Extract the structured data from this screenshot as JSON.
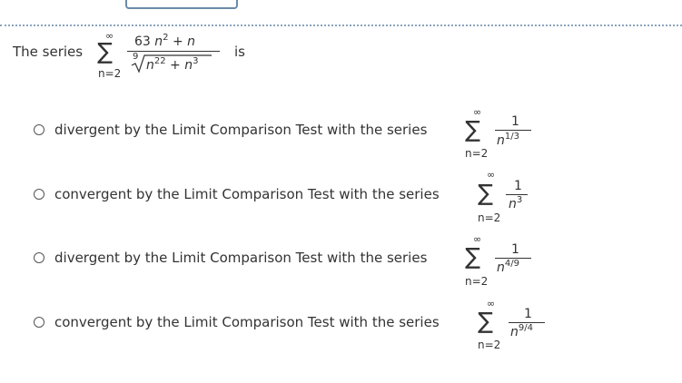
{
  "question": {
    "prefix": "The series",
    "suffix": "is",
    "sum_upper": "∞",
    "sum_lower": "n=2",
    "numerator": "63 n² + n",
    "root_index": "9",
    "radicand": "n²² + n³"
  },
  "options": [
    {
      "text": "divergent by the Limit Comparison Test with the series",
      "sum_upper": "∞",
      "sum_lower": "n=2",
      "numerator": "1",
      "denominator": "n^1/3",
      "den_base": "n",
      "den_exp": "1/3"
    },
    {
      "text": "convergent by the Limit Comparison Test with the series",
      "sum_upper": "∞",
      "sum_lower": "n=2",
      "numerator": "1",
      "denominator": "n^3",
      "den_base": "n",
      "den_exp": "3"
    },
    {
      "text": "divergent by the Limit Comparison Test with the series",
      "sum_upper": "∞",
      "sum_lower": "n=2",
      "numerator": "1",
      "denominator": "n^4/9",
      "den_base": "n",
      "den_exp": "4/9"
    },
    {
      "text": "convergent by the Limit Comparison Test with the series",
      "sum_upper": "∞",
      "sum_lower": "n=2",
      "numerator": "1",
      "denominator": "n^9/4",
      "den_base": "n",
      "den_exp": "9/4"
    }
  ],
  "colors": {
    "text": "#333333",
    "rule": "#8aa4bd",
    "radio_border": "#555555"
  }
}
